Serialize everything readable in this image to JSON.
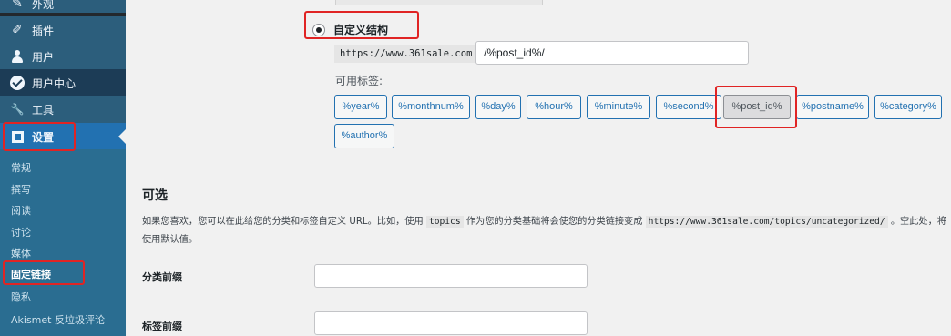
{
  "sidebar": {
    "menu": [
      {
        "label": "外观",
        "icon": "paintbrush-icon",
        "glyph": "✎"
      },
      {
        "label": "插件",
        "icon": "plugin-icon",
        "glyph": "✐"
      },
      {
        "label": "用户",
        "icon": "user-icon",
        "glyph": ""
      },
      {
        "label": "用户中心",
        "icon": "user-center-icon",
        "glyph": ""
      },
      {
        "label": "工具",
        "icon": "wrench-icon",
        "glyph": "🔧"
      },
      {
        "label": "设置",
        "icon": "settings-icon",
        "glyph": ""
      }
    ],
    "submenu": [
      {
        "label": "常规"
      },
      {
        "label": "撰写"
      },
      {
        "label": "阅读"
      },
      {
        "label": "讨论"
      },
      {
        "label": "媒体"
      },
      {
        "label": "固定链接"
      },
      {
        "label": "隐私"
      },
      {
        "label": "Akismet 反垃圾评论"
      }
    ],
    "current_menu": "设置",
    "current_submenu": "固定链接"
  },
  "permalink": {
    "custom_label": "自定义结构",
    "base_url": "https://www.361sale.com",
    "structure_value": "/%post_id%/",
    "available_tags_label": "可用标签:",
    "tags": [
      "%year%",
      "%monthnum%",
      "%day%",
      "%hour%",
      "%minute%",
      "%second%",
      "%post_id%",
      "%postname%",
      "%category%",
      "%author%"
    ],
    "active_tag": "%post_id%"
  },
  "optional": {
    "title": "可选",
    "desc_part1": "如果您喜欢，您可以在此给您的分类和标签自定义 URL。比如，使用",
    "desc_code1": "topics",
    "desc_part2": "作为您的分类基础将会使您的分类链接变成",
    "desc_code2": "https://www.361sale.com/topics/uncategorized/",
    "desc_part3": "。空此处，将使用默认值。",
    "category_base_label": "分类前缀",
    "category_base_value": "",
    "tag_base_label": "标签前缀",
    "tag_base_value": ""
  },
  "colors": {
    "highlight_box": "#e02424",
    "accent": "#2271b1"
  }
}
